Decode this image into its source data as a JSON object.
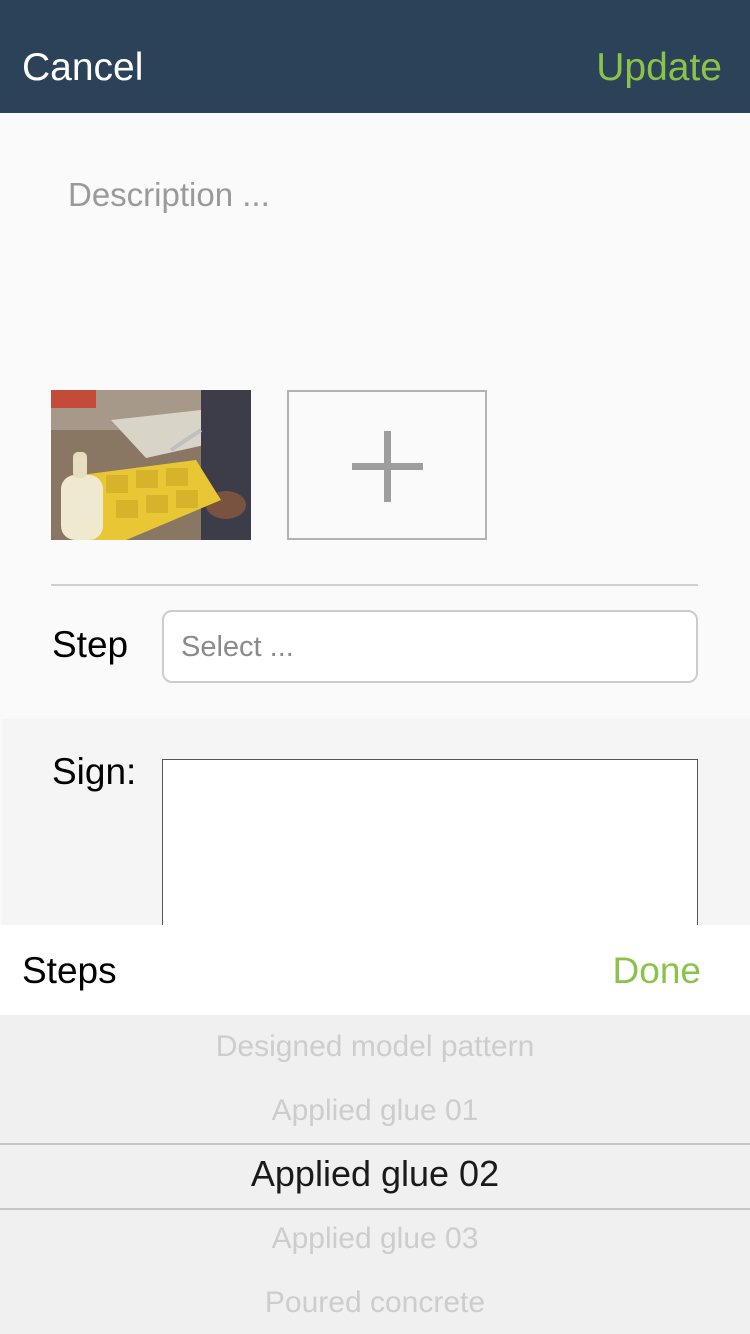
{
  "header": {
    "cancel_label": "Cancel",
    "update_label": "Update",
    "background_color": "#2c4259",
    "accent_color": "#8bc34a"
  },
  "description": {
    "placeholder": "Description ..."
  },
  "photos": {
    "add_icon": "plus-icon"
  },
  "step": {
    "label": "Step",
    "placeholder": "Select ..."
  },
  "sign": {
    "label": "Sign:"
  },
  "picker": {
    "title": "Steps",
    "done_label": "Done",
    "options": [
      "Designed model pattern",
      "Applied glue 01",
      "Applied glue 02",
      "Applied glue 03",
      "Poured concrete"
    ],
    "selected": "Applied glue 02"
  }
}
